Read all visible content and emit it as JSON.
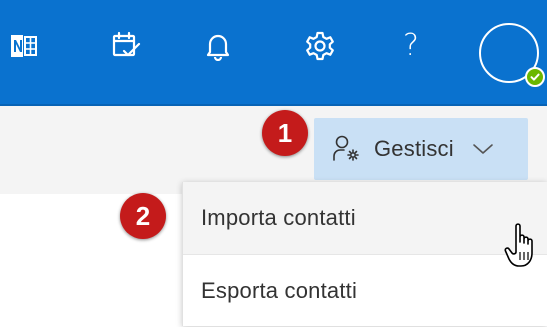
{
  "topbar": {
    "background_color": "#0a72cf",
    "icons": [
      "onenote-icon",
      "calendar-check-icon",
      "bell-icon",
      "gear-icon",
      "help-icon"
    ],
    "help_glyph": "?",
    "presence_status_color": "#6bb700"
  },
  "toolbar": {
    "manage_button_label": "Gestisci",
    "manage_button_color": "#c9e0f5"
  },
  "annotations": {
    "step_1": "1",
    "step_2": "2",
    "badge_color": "#c41b1b"
  },
  "manage_menu": {
    "items": [
      {
        "label": "Importa contatti",
        "hovered": true
      },
      {
        "label": "Esporta contatti",
        "hovered": false
      }
    ]
  }
}
